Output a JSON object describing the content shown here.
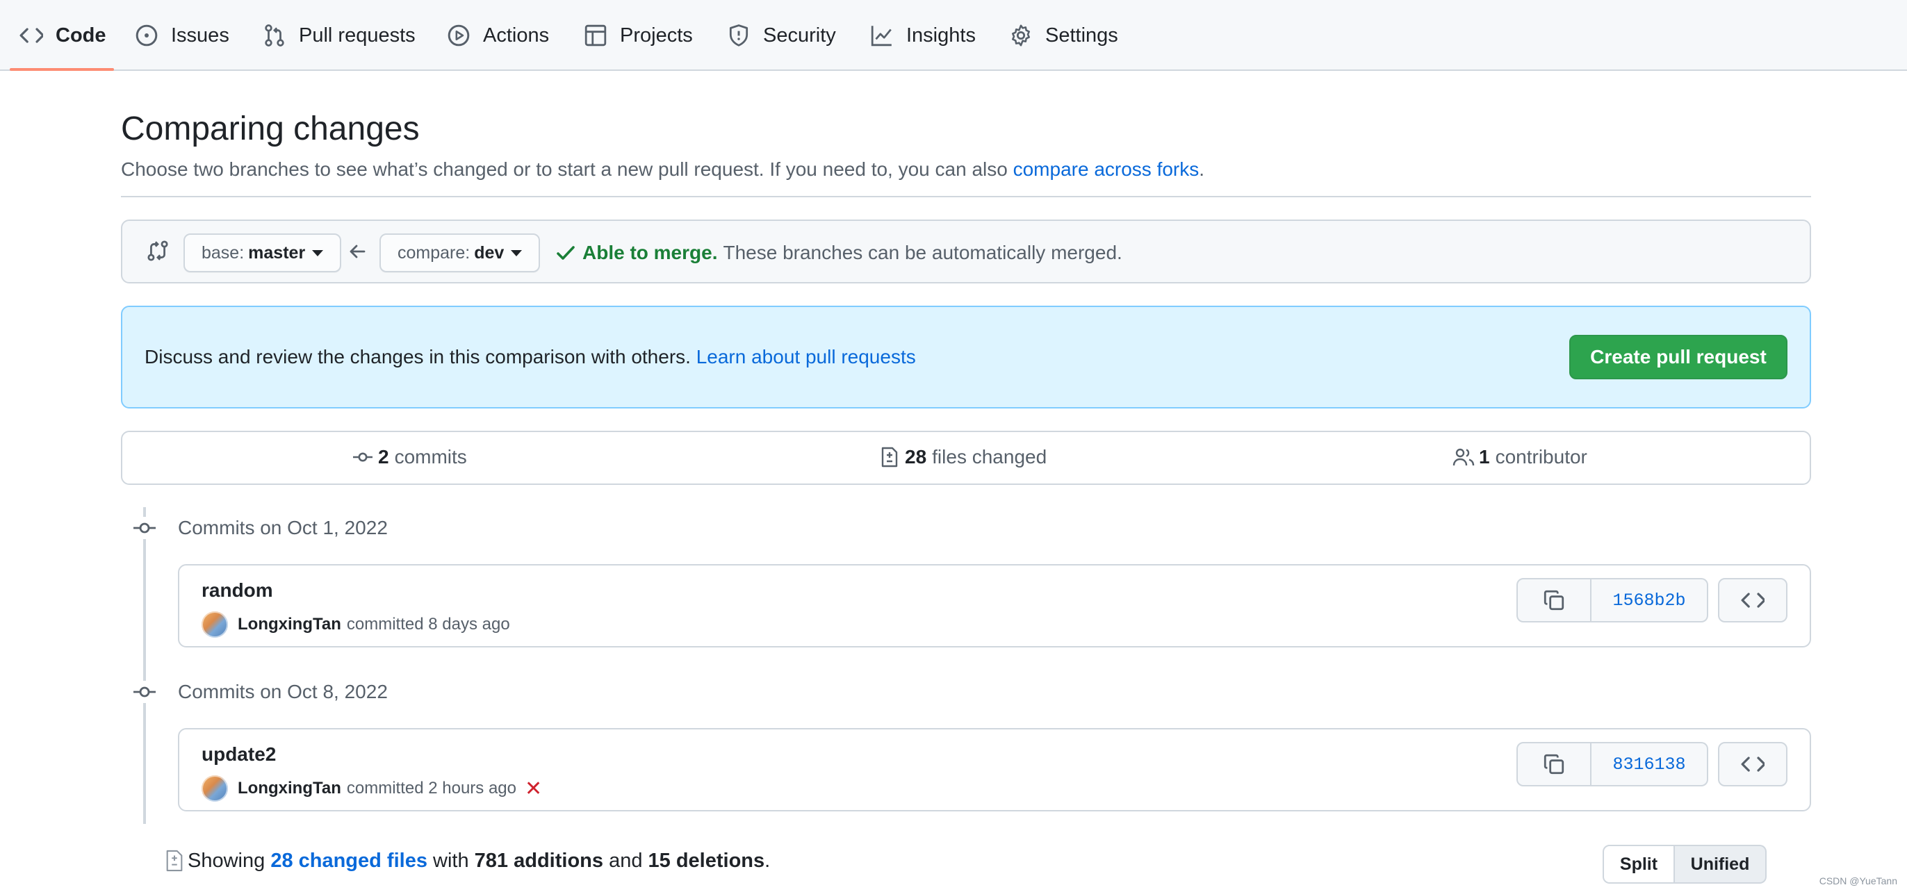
{
  "nav": {
    "tabs": [
      {
        "label": "Code",
        "icon": "code-icon",
        "active": true
      },
      {
        "label": "Issues",
        "icon": "issue-opened-icon"
      },
      {
        "label": "Pull requests",
        "icon": "git-pull-request-icon"
      },
      {
        "label": "Actions",
        "icon": "play-icon"
      },
      {
        "label": "Projects",
        "icon": "table-icon"
      },
      {
        "label": "Security",
        "icon": "shield-icon"
      },
      {
        "label": "Insights",
        "icon": "graph-icon"
      },
      {
        "label": "Settings",
        "icon": "gear-icon"
      }
    ]
  },
  "header": {
    "title": "Comparing changes",
    "subtitle_prefix": "Choose two branches to see what’s changed or to start a new pull request. If you need to, you can also ",
    "subtitle_link": "compare across forks",
    "subtitle_suffix": "."
  },
  "range": {
    "base_label": "base:",
    "base_value": "master",
    "compare_label": "compare:",
    "compare_value": "dev",
    "merge_ok": "Able to merge.",
    "merge_text": "These branches can be automatically merged."
  },
  "flash": {
    "text": "Discuss and review the changes in this comparison with others.",
    "link": "Learn about pull requests",
    "button": "Create pull request"
  },
  "summary": {
    "commits_count": "2",
    "commits_label": "commits",
    "files_count": "28",
    "files_label": "files changed",
    "contributors_count": "1",
    "contributors_label": "contributor"
  },
  "timeline": [
    {
      "date": "Commits on Oct 1, 2022",
      "commit": {
        "title": "random",
        "author": "LongxingTan",
        "meta": "committed 8 days ago",
        "sha": "1568b2b",
        "failed": false
      }
    },
    {
      "date": "Commits on Oct 8, 2022",
      "commit": {
        "title": "update2",
        "author": "LongxingTan",
        "meta": "committed 2 hours ago",
        "sha": "8316138",
        "failed": true
      }
    }
  ],
  "diffbar": {
    "showing": "Showing",
    "files_link": "28 changed files",
    "with": "with",
    "additions": "781 additions",
    "and": "and",
    "deletions": "15 deletions",
    "period": ".",
    "split": "Split",
    "unified": "Unified"
  },
  "watermark": "CSDN @YueTann",
  "colors": {
    "accent": "#0969da",
    "success": "#2da44e",
    "danger": "#cf222e",
    "tab_underline": "#fd8c73"
  }
}
